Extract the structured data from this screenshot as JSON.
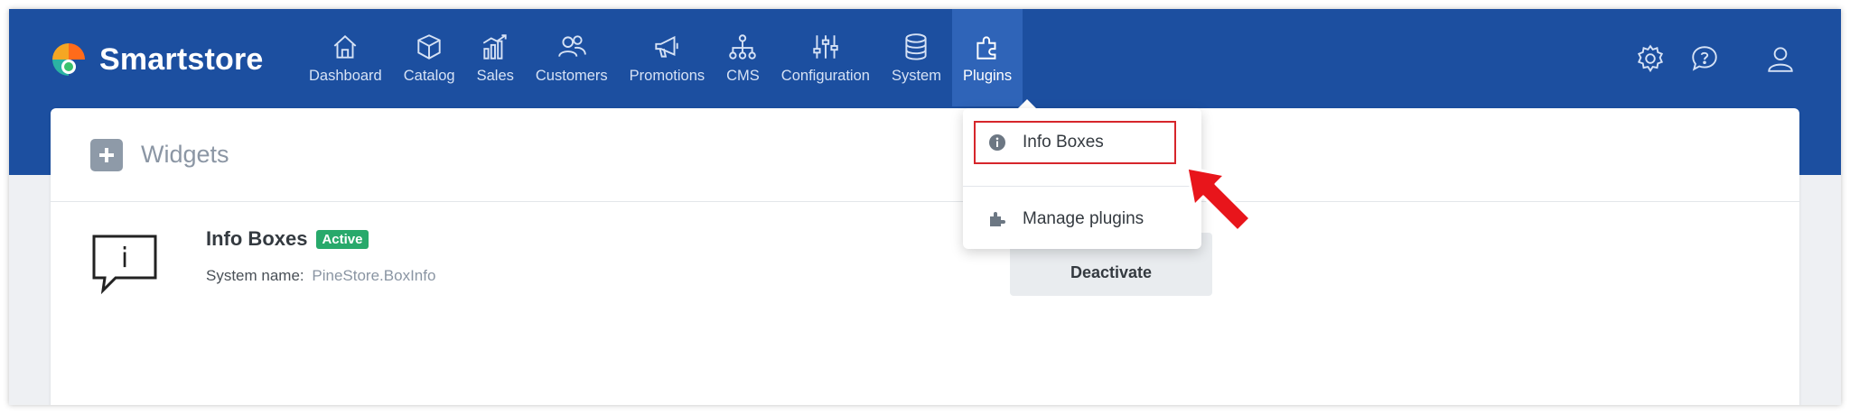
{
  "brand": {
    "name": "Smartstore"
  },
  "nav": [
    {
      "label": "Dashboard",
      "icon": "home-icon"
    },
    {
      "label": "Catalog",
      "icon": "box-icon"
    },
    {
      "label": "Sales",
      "icon": "bar-chart-icon"
    },
    {
      "label": "Customers",
      "icon": "users-icon"
    },
    {
      "label": "Promotions",
      "icon": "megaphone-icon"
    },
    {
      "label": "CMS",
      "icon": "sitemap-icon"
    },
    {
      "label": "Configuration",
      "icon": "sliders-icon"
    },
    {
      "label": "System",
      "icon": "database-icon"
    },
    {
      "label": "Plugins",
      "icon": "puzzle-icon",
      "active": true
    }
  ],
  "panel": {
    "title": "Widgets"
  },
  "plugin": {
    "name": "Info Boxes",
    "badge": "Active",
    "system_name_label": "System name:",
    "system_name_value": "PineStore.BoxInfo",
    "action_label": "Deactivate"
  },
  "dropdown": {
    "items": [
      {
        "label": "Info Boxes",
        "icon": "info-circle-icon"
      },
      {
        "label": "Manage plugins",
        "icon": "puzzle-icon"
      }
    ]
  },
  "colors": {
    "brand_blue": "#1c4fa0",
    "active_nav": "#2f64b8",
    "badge_green": "#28a96b",
    "highlight_red": "#d6262b"
  }
}
